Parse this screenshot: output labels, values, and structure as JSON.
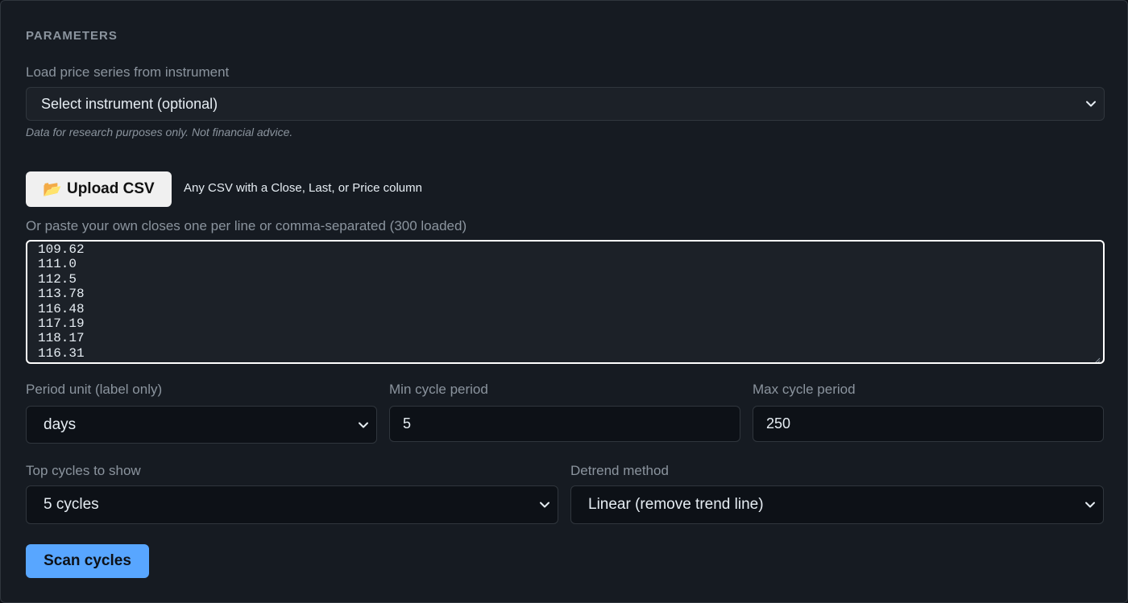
{
  "section": {
    "title": "PARAMETERS"
  },
  "instrument": {
    "label": "Load price series from instrument",
    "selected": "Select instrument (optional)",
    "note": "Data for research purposes only. Not financial advice."
  },
  "upload": {
    "icon": "📂",
    "button_label": "Upload CSV",
    "hint": "Any CSV with a Close, Last, or Price column"
  },
  "paste": {
    "label": "Or paste your own closes one per line or comma-separated (300 loaded)",
    "lines": [
      "109.62",
      "111.0",
      "112.5",
      "113.78",
      "116.48",
      "117.19",
      "118.17",
      "116.31"
    ]
  },
  "period_unit": {
    "label": "Period unit (label only)",
    "selected": "days"
  },
  "min_cycle": {
    "label": "Min cycle period",
    "value": "5"
  },
  "max_cycle": {
    "label": "Max cycle period",
    "value": "250"
  },
  "top_cycles": {
    "label": "Top cycles to show",
    "selected": "5 cycles"
  },
  "detrend": {
    "label": "Detrend method",
    "selected": "Linear (remove trend line)"
  },
  "scan_button": {
    "label": "Scan cycles"
  },
  "colors": {
    "accent": "#58a6ff",
    "panel_bg": "#161b22",
    "input_bg": "#0d1117",
    "muted_text": "#8b949e"
  }
}
